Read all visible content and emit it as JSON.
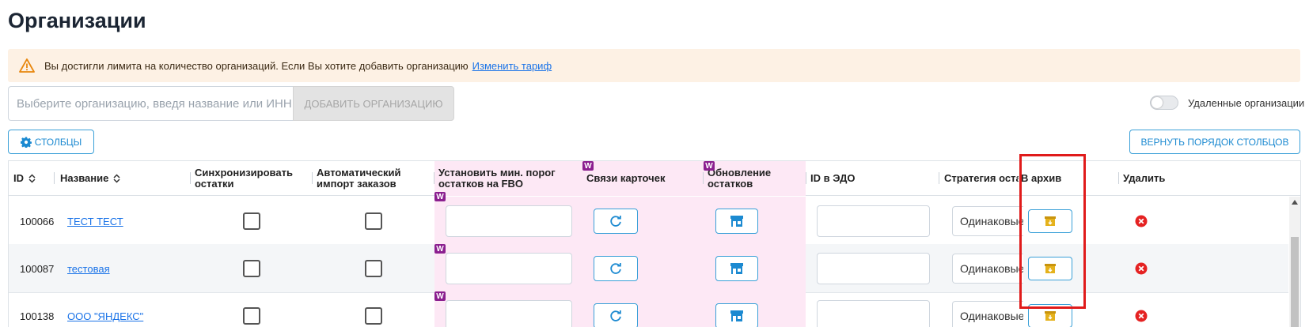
{
  "page": {
    "title": "Организации"
  },
  "alert": {
    "message": "Вы достигли лимита на количество организаций. Если Вы хотите добавить организацию",
    "link": "Изменить тариф"
  },
  "search": {
    "placeholder": "Выберите организацию, введя название или ИНН",
    "value": ""
  },
  "add_button": "ДОБАВИТЬ ОРГАНИЗАЦИЮ",
  "deleted_toggle": {
    "label": "Удаленные организации",
    "checked": false
  },
  "columns_button": "СТОЛБЦЫ",
  "reset_order_button": "ВЕРНУТЬ ПОРЯДОК СТОЛБЦОВ",
  "badge_text": "W",
  "headers": {
    "id": "ID",
    "name": "Название",
    "sync": "Синхронизировать остатки",
    "auto_import": "Автоматический импорт заказов",
    "min_threshold": "Установить мин. порог остатков на FBO",
    "card_links": "Связи карточек",
    "stock_update": "Обновление остатков",
    "edo_id": "ID в ЭДО",
    "strategy": "Стратегия остатков",
    "archive": "В архив",
    "delete": "Удалить"
  },
  "rows": [
    {
      "id": "100066",
      "name": "ТЕСТ ТЕСТ",
      "strategy": "Одинаковые"
    },
    {
      "id": "100087",
      "name": "тестовая",
      "strategy": "Одинаковые"
    },
    {
      "id": "100138",
      "name": "ООО \"ЯНДЕКС\"",
      "strategy": "Одинаковые"
    }
  ],
  "colors": {
    "accent": "#1c8ad1",
    "alert_bg": "#fdf1e4",
    "marketplace_badge": "#8b1f8f",
    "column_tint": "#fde8f5",
    "delete_icon": "#e52222",
    "archive_icon": "#e5b21c",
    "highlight": "#e01b1b"
  },
  "icons": {
    "alert": "warning-triangle-icon",
    "columns": "gear-icon",
    "sort": "sort-updown-icon",
    "card_links": "refresh-icon",
    "stock_update": "store-icon",
    "archive": "archive-box-icon",
    "delete": "delete-circle-icon"
  }
}
